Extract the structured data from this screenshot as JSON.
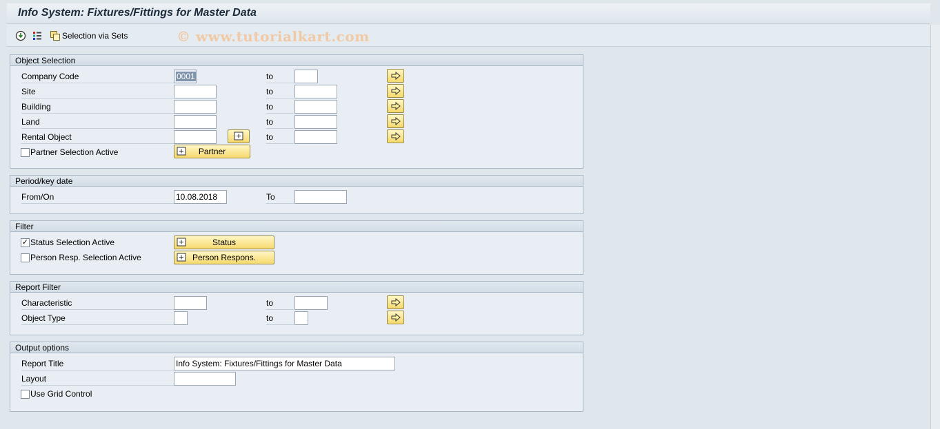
{
  "window": {
    "title": "Info System: Fixtures/Fittings for Master Data"
  },
  "toolbar": {
    "execute_icon": "execute-icon",
    "variants_icon": "variants-icon",
    "sets_icon": "selection-sets-icon",
    "sets_label": "Selection via Sets",
    "watermark": "© www.tutorialkart.com"
  },
  "object_selection": {
    "header": "Object Selection",
    "to_label": "to",
    "rows": [
      {
        "label": "Company Code",
        "from": "0001",
        "to": ""
      },
      {
        "label": "Site",
        "from": "",
        "to": ""
      },
      {
        "label": "Building",
        "from": "",
        "to": ""
      },
      {
        "label": "Land",
        "from": "",
        "to": ""
      },
      {
        "label": "Rental Object",
        "from": "",
        "to": ""
      }
    ],
    "partner_checkbox_label": "Partner Selection Active",
    "partner_checked": false,
    "partner_button": "Partner"
  },
  "period": {
    "header": "Period/key date",
    "from_label": "From/On",
    "from_value": "10.08.2018",
    "to_label": "To",
    "to_value": ""
  },
  "filter": {
    "header": "Filter",
    "status_label": "Status Selection Active",
    "status_checked": true,
    "status_button": "Status",
    "person_label": "Person Resp. Selection Active",
    "person_checked": false,
    "person_button": "Person Respons."
  },
  "report_filter": {
    "header": "Report Filter",
    "to_label": "to",
    "rows": [
      {
        "label": "Characteristic",
        "from": "",
        "to": ""
      },
      {
        "label": "Object Type",
        "from": "",
        "to": ""
      }
    ]
  },
  "output": {
    "header": "Output options",
    "report_title_label": "Report Title",
    "report_title_value": "Info System: Fixtures/Fittings for Master Data",
    "layout_label": "Layout",
    "layout_value": "",
    "grid_label": "Use Grid Control",
    "grid_checked": false
  },
  "colors": {
    "background": "#dfe6ec",
    "button_yellow": "#f6d96e",
    "watermark": "#f0c9a6"
  }
}
